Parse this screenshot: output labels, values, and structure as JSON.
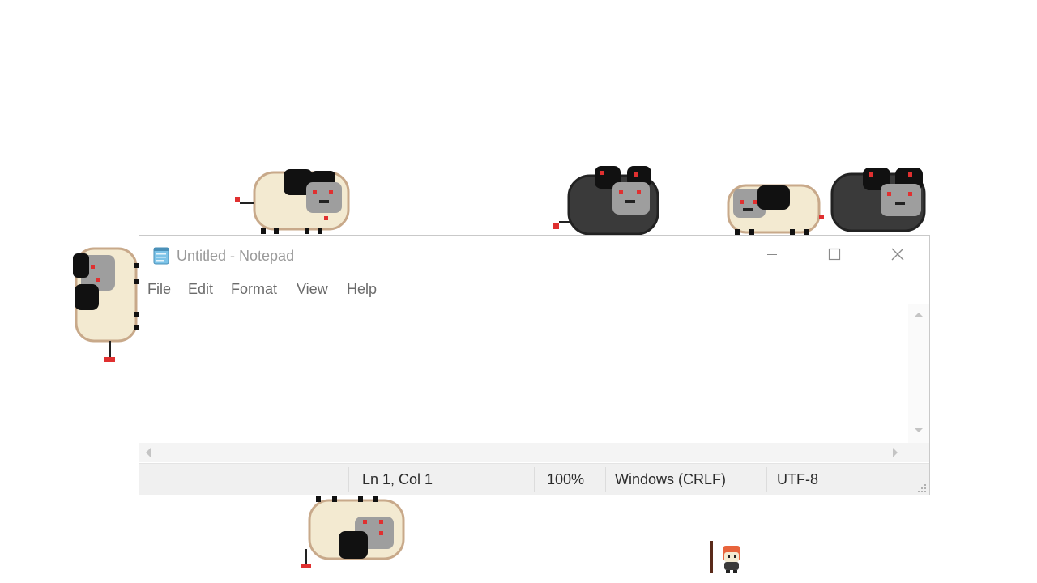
{
  "window": {
    "title": "Untitled - Notepad",
    "app_icon": "notepad-icon",
    "controls": [
      "minimize-icon",
      "maximize-icon",
      "close-icon"
    ]
  },
  "menu": {
    "items": [
      {
        "label": "File"
      },
      {
        "label": "Edit"
      },
      {
        "label": "Format"
      },
      {
        "label": "View"
      },
      {
        "label": "Help"
      }
    ]
  },
  "editor": {
    "text": ""
  },
  "status": {
    "position": "Ln 1, Col 1",
    "zoom": "100%",
    "line_ending": "Windows (CRLF)",
    "encoding": "UTF-8"
  },
  "desktop_pets": [
    {
      "name": "sheep-cream",
      "color": "#f3ead1"
    },
    {
      "name": "sheep-black",
      "color": "#3a3a3a"
    },
    {
      "name": "small-character",
      "color": "#e8643c"
    }
  ],
  "colors": {
    "window_border": "#c9c9c9",
    "statusbar_bg": "#f0f0f0",
    "title_text": "#9a9a9a",
    "menu_text": "#6b6b6b",
    "status_text": "#2b2b2b"
  }
}
